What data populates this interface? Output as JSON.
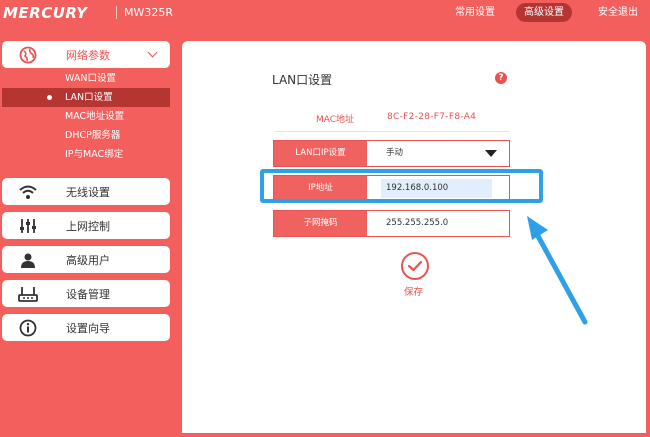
{
  "header": {
    "logo": "MERCURY",
    "model": "MW325R",
    "nav": [
      {
        "label": "常用设置",
        "active": false
      },
      {
        "label": "高级设置",
        "active": true
      },
      {
        "label": "安全退出",
        "active": false
      }
    ]
  },
  "sidebar": {
    "network": {
      "label": "网络参数",
      "icon": "globe-icon",
      "subitems": [
        "WAN口设置",
        "LAN口设置",
        "MAC地址设置",
        "DHCP服务器",
        "IP与MAC绑定"
      ],
      "active_subitem": "LAN口设置"
    },
    "items": [
      {
        "label": "无线设置",
        "icon": "wifi-icon"
      },
      {
        "label": "上网控制",
        "icon": "sliders-icon"
      },
      {
        "label": "高级用户",
        "icon": "user-icon"
      },
      {
        "label": "设备管理",
        "icon": "router-icon"
      },
      {
        "label": "设置向导",
        "icon": "info-icon"
      }
    ]
  },
  "panel": {
    "title": "LAN口设置",
    "help_icon": "question-icon",
    "mac_label": "MAC地址",
    "mac_value": "8C-F2-28-F7-F8-A4",
    "ip_mode_label": "LAN口IP设置",
    "ip_mode_value": "手动",
    "ip_label": "IP地址",
    "ip_value": "192.168.0.100",
    "mask_label": "子网掩码",
    "mask_value": "255.255.255.0",
    "save_label": "保存"
  },
  "colors": {
    "brand": "#f25f5c",
    "accent": "#e8524f",
    "active_dark": "#b53533",
    "annotation": "#2f9fe6"
  }
}
